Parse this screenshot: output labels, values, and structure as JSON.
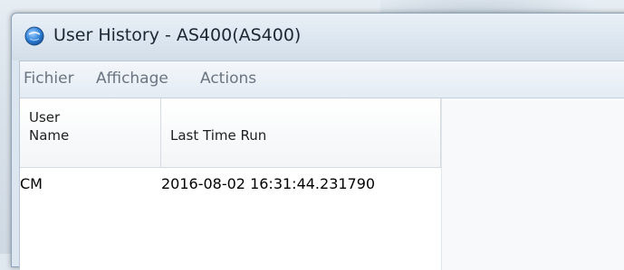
{
  "window": {
    "title": "User History - AS400(AS400)",
    "icon": "globe-app-icon"
  },
  "menu": {
    "items": [
      {
        "label": "Fichier"
      },
      {
        "label": "Affichage"
      },
      {
        "label": "Actions"
      }
    ]
  },
  "table": {
    "columns": [
      {
        "line1": "User",
        "line2": "Name"
      },
      {
        "line1": "",
        "line2": "Last Time Run"
      }
    ],
    "rows": [
      {
        "user_name": "CM",
        "last_time_run": "2016-08-02 16:31:44.231790"
      }
    ]
  },
  "colors": {
    "title_icon_blue": "#2f7fd6",
    "window_frame": "#dbe6f1",
    "menu_text": "#6b7480"
  }
}
